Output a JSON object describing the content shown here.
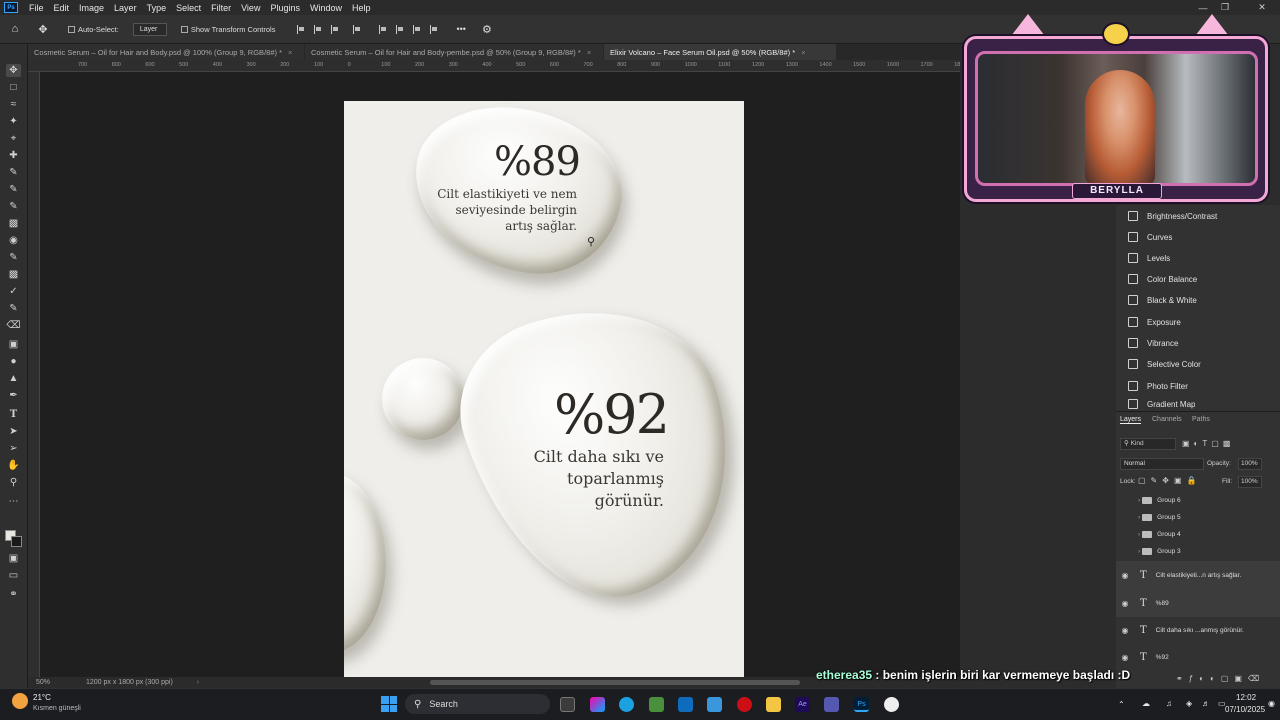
{
  "app": {
    "menu": [
      "File",
      "Edit",
      "Image",
      "Layer",
      "Type",
      "Select",
      "Filter",
      "View",
      "Plugins",
      "Window",
      "Help"
    ],
    "ps_logo": "Ps"
  },
  "options_bar": {
    "auto_select_label": "Auto-Select:",
    "auto_select_value": "Layer",
    "transform_controls_label": "Show Transform Controls",
    "more": "•••"
  },
  "tabs": [
    {
      "label": "Cosmetic Serum – Oil for Hair and Body.psd @ 100% (Group 9, RGB/8#) *",
      "close": "×"
    },
    {
      "label": "Cosmetic Serum – Oil for Hair and Body-pembe.psd @ 50% (Group 9, RGB/8#) *",
      "close": "×"
    },
    {
      "label": "Elixir Volcano – Face Serum Oil.psd @ 50% (RGB/8#) *",
      "close": "×"
    }
  ],
  "ruler_marks": [
    "700",
    "800",
    "600",
    "500",
    "400",
    "300",
    "200",
    "100",
    "0",
    "100",
    "200",
    "300",
    "400",
    "500",
    "600",
    "700",
    "800",
    "900",
    "1000",
    "1100",
    "1200",
    "1300",
    "1400",
    "1500",
    "1600",
    "1700",
    "1800",
    "1900"
  ],
  "artboard": {
    "stat1_number": "%89",
    "stat1_line1": "Cilt elastikiyeti ve nem",
    "stat1_line2": "seviyesinde belirgin",
    "stat1_line3": "artış sağlar.",
    "stat2_number": "%92",
    "stat2_line1": "Cilt daha sıkı ve",
    "stat2_line2": "toparlanmış",
    "stat2_line3": "görünür."
  },
  "status": {
    "zoom": "50%",
    "doc_size": "1200 px x 1800 px (300 ppi)"
  },
  "adjustments": [
    "Brightness/Contrast",
    "Curves",
    "Levels",
    "Color Balance",
    "Black & White",
    "Exposure",
    "Vibrance",
    "Selective Color",
    "Photo Filter",
    "Gradient Map"
  ],
  "layers_panel": {
    "tabs": [
      "Layers",
      "Channels",
      "Paths"
    ],
    "kind_label": "Kind",
    "blend_mode": "Normal",
    "opacity_label": "Opacity:",
    "opacity_value": "100%",
    "lock_label": "Lock:",
    "fill_label": "Fill:",
    "fill_value": "100%",
    "groups": [
      "Group 6",
      "Group 5",
      "Group 4",
      "Group 3"
    ],
    "text_layers": [
      "Cilt elastikiyeti...n  artış sağlar.",
      "%89",
      "Cilt daha sıkı ...anmış görünür.",
      "%92"
    ]
  },
  "webcam": {
    "name": "BERYLLA"
  },
  "chat": {
    "user": "etherea35",
    "message": " : benim işlerin biri kar vermemeye başladı :D"
  },
  "taskbar": {
    "weather_temp": "21°C",
    "weather_desc": "Kısmen güneşli",
    "search_placeholder": "Search",
    "time": "12:02",
    "date": "07/10/2025"
  }
}
